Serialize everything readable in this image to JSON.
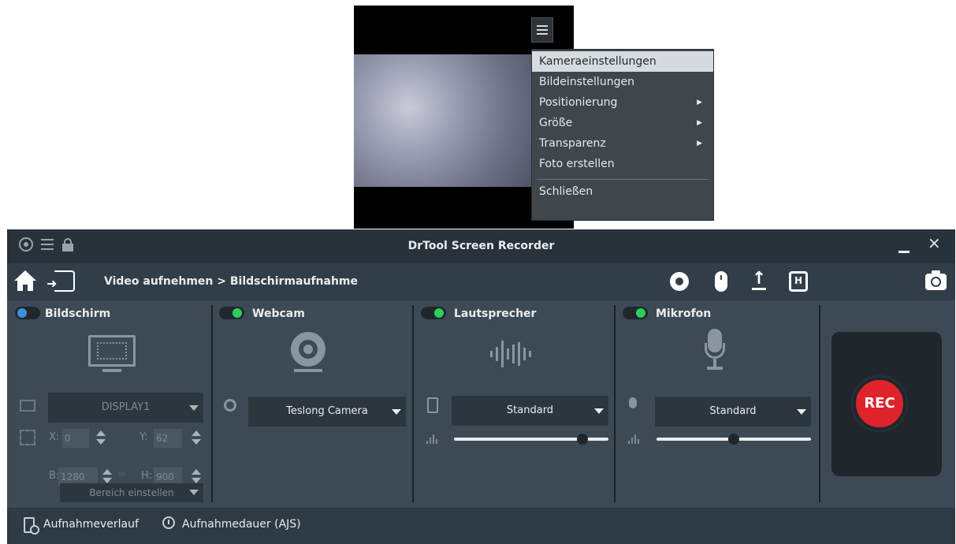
{
  "preview": {
    "menu_button_icon": "hamburger-icon"
  },
  "context_menu": {
    "items": [
      {
        "label": "Kameraeinstellungen",
        "active": true,
        "submenu": false
      },
      {
        "label": "Bildeinstellungen",
        "active": false,
        "submenu": false
      },
      {
        "label": "Positionierung",
        "active": false,
        "submenu": true
      },
      {
        "label": "Größe",
        "active": false,
        "submenu": true
      },
      {
        "label": "Transparenz",
        "active": false,
        "submenu": true
      },
      {
        "label": "Foto erstellen",
        "active": false,
        "submenu": false
      }
    ],
    "close_label": "Schließen"
  },
  "window": {
    "title": "DrTool Screen Recorder",
    "close_symbol": "×"
  },
  "navbar": {
    "breadcrumb": "Video aufnehmen > Bildschirmaufnahme",
    "hotkey_label": "H"
  },
  "panels": {
    "screen": {
      "title": "Bildschirm",
      "enabled": false,
      "display_select": "DISPLAY1",
      "x_label": "X:",
      "x_value": "0",
      "y_label": "Y:",
      "y_value": "62",
      "w_label": "B:",
      "w_value": "1280",
      "h_label": "H:",
      "h_value": "900",
      "region_select": "Bereich einstellen"
    },
    "webcam": {
      "title": "Webcam",
      "enabled": true,
      "camera_select": "Teslong Camera"
    },
    "speaker": {
      "title": "Lautsprecher",
      "enabled": true,
      "device_select": "Standard",
      "volume": 0.83
    },
    "microphone": {
      "title": "Mikrofon",
      "enabled": true,
      "device_select": "Standard",
      "volume": 0.5
    }
  },
  "rec_button": "REC",
  "footer": {
    "history": "Aufnahmeverlauf",
    "duration": "Aufnahmedauer (AJS)"
  },
  "colors": {
    "rec_red": "#e0232b",
    "toggle_on": "#2bd05a",
    "toggle_off": "#3d8fe0",
    "panel_bg": "#3d4a55"
  }
}
